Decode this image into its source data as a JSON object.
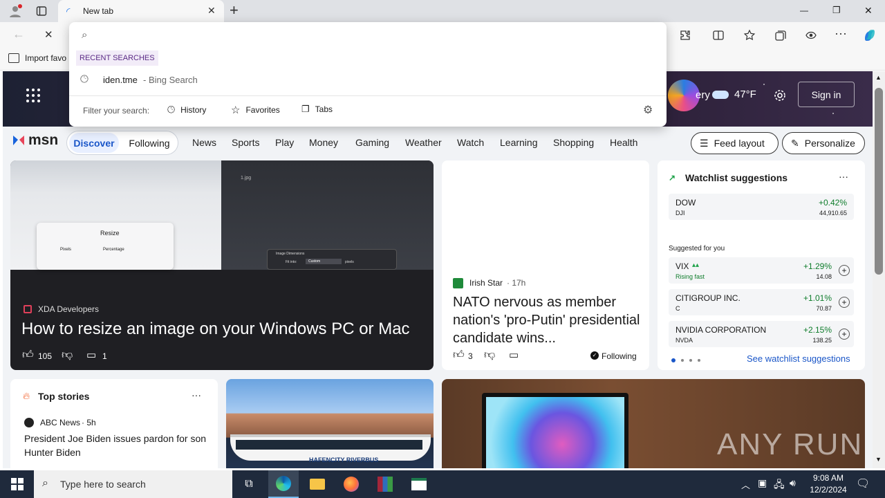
{
  "browser": {
    "tab_title": "New tab",
    "new_tab_symbol": "+",
    "favorites_import": "Import favo",
    "minimize": "—",
    "restore": "❐",
    "close": "✕"
  },
  "dropdown": {
    "recent_header": "RECENT SEARCHES",
    "recent_item": "iden.tme",
    "recent_suffix": " - Bing Search",
    "filter_label": "Filter your search:",
    "filters": [
      "History",
      "Favorites",
      "Tabs"
    ]
  },
  "hero": {
    "weather_temp": "47°F",
    "sign_in": "Sign in",
    "partial_text": "ery"
  },
  "msn": {
    "logo": "msn",
    "tabs": [
      "Discover",
      "Following"
    ],
    "nav": [
      "News",
      "Sports",
      "Play",
      "Money",
      "Gaming",
      "Weather",
      "Watch",
      "Learning",
      "Shopping",
      "Health"
    ],
    "feed_layout": "Feed layout",
    "personalize": "Personalize"
  },
  "main_story": {
    "source": "XDA Developers",
    "headline": "How to resize an image on your Windows PC or Mac",
    "likes": "105",
    "comments": "1",
    "img_resize": "Resize",
    "img_pixels": "Pixels",
    "img_percentage": "Percentage",
    "img_dims": "Image Dimensions",
    "img_fit": "Fit into:",
    "img_custom": "Custom",
    "img_px": "pixels",
    "img_file": "1.jpg"
  },
  "second_story": {
    "source": "Irish Star",
    "time": "· 17h",
    "headline": "NATO nervous as member nation's 'pro-Putin' presidential candidate wins...",
    "likes": "3",
    "following": "Following"
  },
  "watchlist": {
    "title": "Watchlist suggestions",
    "more": "···",
    "suggested": "Suggested for you",
    "see_all": "See watchlist suggestions",
    "stocks": [
      {
        "name": "DOW",
        "ticker": "DJI",
        "change": "+0.42%",
        "price": "44,910.65",
        "note": ""
      },
      {
        "name": "VIX",
        "ticker": "Rising fast",
        "change": "+1.29%",
        "price": "14.08",
        "note": "rising"
      },
      {
        "name": "CITIGROUP INC.",
        "ticker": "C",
        "change": "+1.01%",
        "price": "70.87",
        "note": ""
      },
      {
        "name": "NVIDIA CORPORATION",
        "ticker": "NVDA",
        "change": "+2.15%",
        "price": "138.25",
        "note": ""
      }
    ]
  },
  "top_stories": {
    "title": "Top stories",
    "more": "···",
    "source": "ABC News",
    "time": "· 5h",
    "headline": "President Joe Biden issues pardon for son Hunter Biden"
  },
  "boat_image": {
    "text": "HAFENCITY RIVERBUS"
  },
  "watermark": "ANY RUN",
  "taskbar": {
    "search_placeholder": "Type here to search",
    "time": "9:08 AM",
    "date": "12/2/2024"
  }
}
